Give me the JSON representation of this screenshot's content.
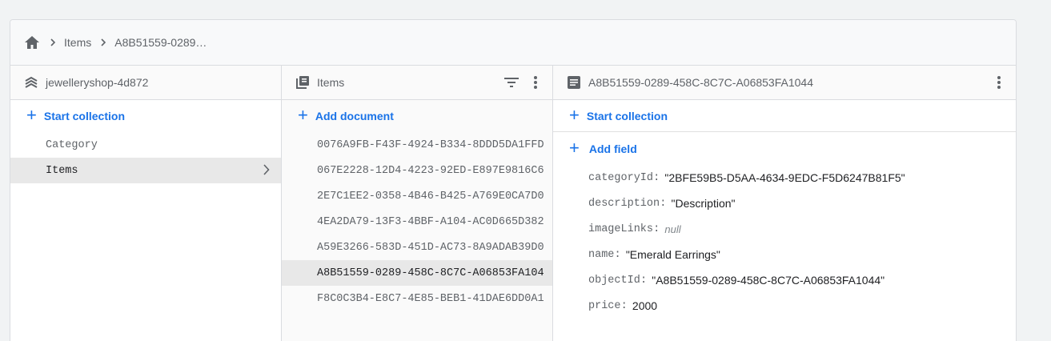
{
  "breadcrumb": {
    "items": [
      "Items",
      "A8B51559-0289…"
    ]
  },
  "columns": {
    "project": {
      "title": "jewelleryshop-4d872",
      "add_label": "Start collection",
      "collections": [
        "Category",
        "Items"
      ]
    },
    "collection": {
      "title": "Items",
      "add_label": "Add document",
      "documents": [
        "0076A9FB-F43F-4924-B334-8DDD5DA1FFD",
        "067E2228-12D4-4223-92ED-E897E9816C6",
        "2E7C1EE2-0358-4B46-B425-A769E0CA7D0",
        "4EA2DA79-13F3-4BBF-A104-AC0D665D382",
        "A59E3266-583D-451D-AC73-8A9ADAB39D0",
        "A8B51559-0289-458C-8C7C-A06853FA104",
        "F8C0C3B4-E8C7-4E85-BEB1-41DAE6DD0A1"
      ]
    },
    "document": {
      "title": "A8B51559-0289-458C-8C7C-A06853FA1044",
      "start_collection_label": "Start collection",
      "add_field_label": "Add field",
      "fields": [
        {
          "key": "categoryId",
          "value": "\"2BFE59B5-D5AA-4634-9EDC-F5D6247B81F5\""
        },
        {
          "key": "description",
          "value": "\"Description\""
        },
        {
          "key": "imageLinks",
          "value": "null"
        },
        {
          "key": "name",
          "value": "\"Emerald Earrings\""
        },
        {
          "key": "objectId",
          "value": "\"A8B51559-0289-458C-8C7C-A06853FA1044\""
        },
        {
          "key": "price",
          "value": "2000"
        }
      ]
    }
  },
  "colors": {
    "accent": "#1a73e8",
    "selected_bg": "#e8e8e8"
  },
  "icons": {
    "home": "home-icon",
    "project": "database-stack-icon",
    "collection": "collection-icon",
    "document": "document-icon",
    "filter": "filter-icon",
    "more": "more-vert-icon",
    "chevron": "chevron-right-icon"
  }
}
